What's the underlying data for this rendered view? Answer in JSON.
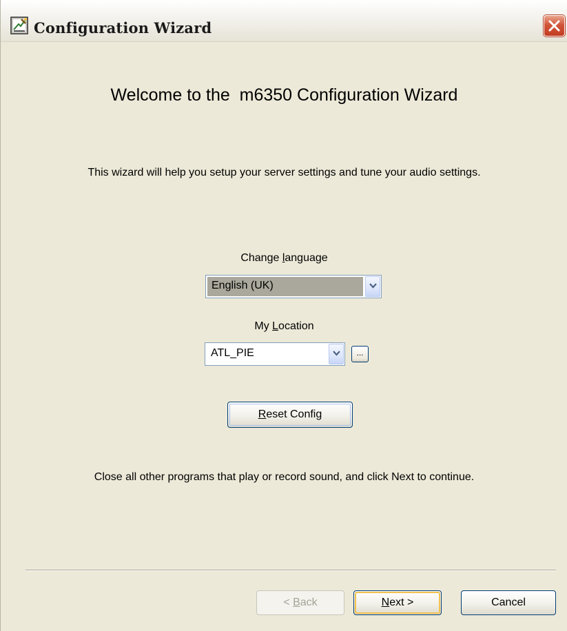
{
  "window": {
    "title": "Configuration Wizard"
  },
  "icons": {
    "app": "wizard-app-icon",
    "close": "close-icon",
    "dropdown": "chevron-down-icon"
  },
  "colors": {
    "dialog_bg": "#ece9d8",
    "close_button": "#d2563a",
    "focus_border": "#f4c14f",
    "field_border": "#7f9db9"
  },
  "page": {
    "heading": "Welcome to the  m6350 Configuration Wizard",
    "intro": "This wizard will help you setup your server settings and tune your audio settings.",
    "language": {
      "label_pre": "Change ",
      "label_key": "l",
      "label_post": "anguage",
      "selected": "English (UK)"
    },
    "location": {
      "label_pre": "My ",
      "label_key": "L",
      "label_post": "ocation",
      "selected": "ATL_PIE",
      "browse_label": "..."
    },
    "reset": {
      "key": "R",
      "rest": "eset Config"
    },
    "footer": "Close all other programs that play or record sound, and click Next to continue."
  },
  "buttons": {
    "back": {
      "prefix": "< ",
      "key": "B",
      "rest": "ack"
    },
    "next": {
      "key": "N",
      "rest": "ext >"
    },
    "cancel": "Cancel"
  }
}
